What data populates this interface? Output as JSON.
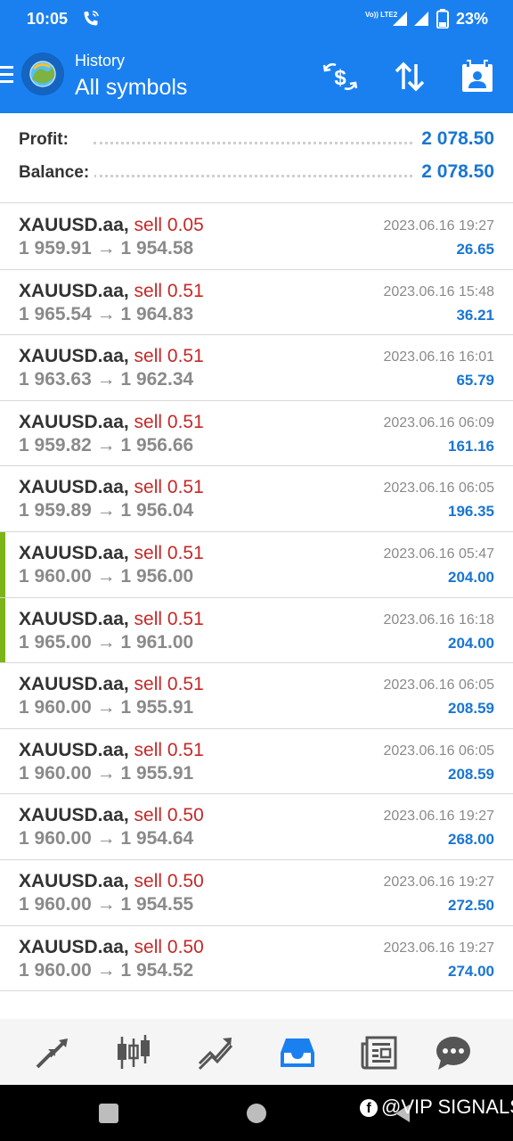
{
  "status_bar": {
    "time": "10:05",
    "network": "Vo)) LTE2",
    "battery": "23%"
  },
  "app_bar": {
    "subtitle": "History",
    "title": "All symbols"
  },
  "summary": {
    "profit_label": "Profit:",
    "profit_value": "2 078.50",
    "balance_label": "Balance:",
    "balance_value": "2 078.50"
  },
  "trades": [
    {
      "symbol": "XAUUSD.aa,",
      "side": "sell 0.05",
      "open": "1 959.91",
      "close": "1 954.58",
      "date": "2023.06.16 19:27",
      "profit": "26.65",
      "marked": false
    },
    {
      "symbol": "XAUUSD.aa,",
      "side": "sell 0.51",
      "open": "1 965.54",
      "close": "1 964.83",
      "date": "2023.06.16 15:48",
      "profit": "36.21",
      "marked": false
    },
    {
      "symbol": "XAUUSD.aa,",
      "side": "sell 0.51",
      "open": "1 963.63",
      "close": "1 962.34",
      "date": "2023.06.16 16:01",
      "profit": "65.79",
      "marked": false
    },
    {
      "symbol": "XAUUSD.aa,",
      "side": "sell 0.51",
      "open": "1 959.82",
      "close": "1 956.66",
      "date": "2023.06.16 06:09",
      "profit": "161.16",
      "marked": false
    },
    {
      "symbol": "XAUUSD.aa,",
      "side": "sell 0.51",
      "open": "1 959.89",
      "close": "1 956.04",
      "date": "2023.06.16 06:05",
      "profit": "196.35",
      "marked": false
    },
    {
      "symbol": "XAUUSD.aa,",
      "side": "sell 0.51",
      "open": "1 960.00",
      "close": "1 956.00",
      "date": "2023.06.16 05:47",
      "profit": "204.00",
      "marked": true
    },
    {
      "symbol": "XAUUSD.aa,",
      "side": "sell 0.51",
      "open": "1 965.00",
      "close": "1 961.00",
      "date": "2023.06.16 16:18",
      "profit": "204.00",
      "marked": true
    },
    {
      "symbol": "XAUUSD.aa,",
      "side": "sell 0.51",
      "open": "1 960.00",
      "close": "1 955.91",
      "date": "2023.06.16 06:05",
      "profit": "208.59",
      "marked": false
    },
    {
      "symbol": "XAUUSD.aa,",
      "side": "sell 0.51",
      "open": "1 960.00",
      "close": "1 955.91",
      "date": "2023.06.16 06:05",
      "profit": "208.59",
      "marked": false
    },
    {
      "symbol": "XAUUSD.aa,",
      "side": "sell 0.50",
      "open": "1 960.00",
      "close": "1 954.64",
      "date": "2023.06.16 19:27",
      "profit": "268.00",
      "marked": false
    },
    {
      "symbol": "XAUUSD.aa,",
      "side": "sell 0.50",
      "open": "1 960.00",
      "close": "1 954.55",
      "date": "2023.06.16 19:27",
      "profit": "272.50",
      "marked": false
    },
    {
      "symbol": "XAUUSD.aa,",
      "side": "sell 0.50",
      "open": "1 960.00",
      "close": "1 954.52",
      "date": "2023.06.16 19:27",
      "profit": "274.00",
      "marked": false
    }
  ],
  "arrow": "→",
  "bottom_nav": [
    "quotes-icon",
    "chart-icon",
    "trade-icon",
    "history-icon",
    "news-icon",
    "chat-icon"
  ],
  "watermark": {
    "fb": "f",
    "text": "@VIP SIGNALS"
  },
  "colors": {
    "accent": "#1a80f0",
    "sell": "#c62828",
    "profit": "#1976d2",
    "marker": "#7cb518",
    "active_nav": "#1a80f0",
    "inactive_nav": "#555555"
  }
}
